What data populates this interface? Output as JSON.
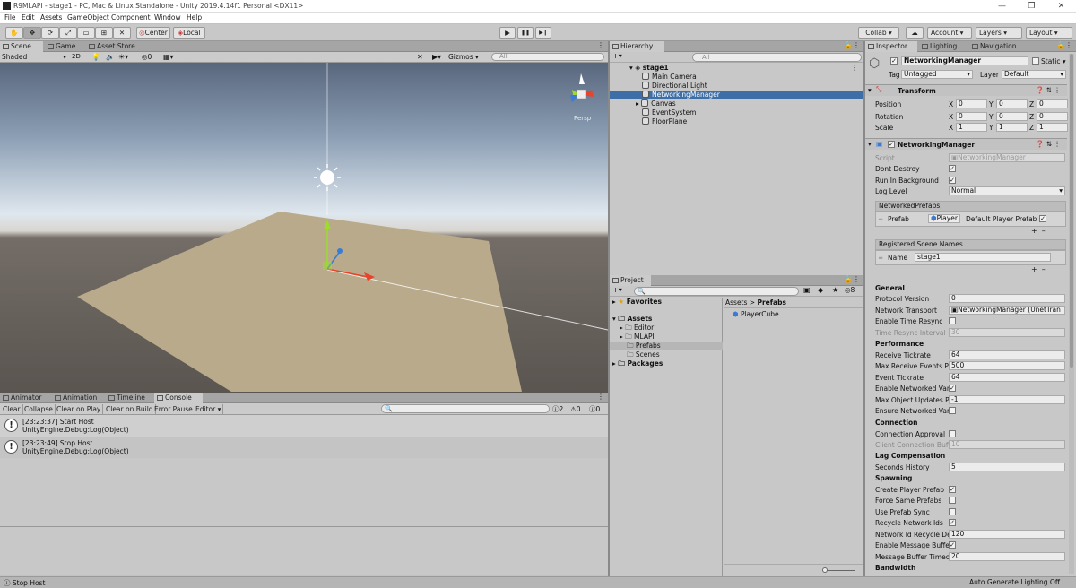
{
  "window": {
    "title": "R9MLAPI - stage1 - PC, Mac & Linux Standalone - Unity 2019.4.14f1 Personal <DX11>",
    "controls": [
      "—",
      "❐",
      "✕"
    ]
  },
  "menu": [
    "File",
    "Edit",
    "Assets",
    "GameObject",
    "Component",
    "Window",
    "Help"
  ],
  "toolbar": {
    "center": "Center",
    "local": "Local",
    "collab": "Collab ▾",
    "account": "Account",
    "layers": "Layers",
    "layout": "Layout",
    "play": "▶",
    "pause": "❚❚",
    "step": "▶❙"
  },
  "scene_tabs": [
    "Scene",
    "Game",
    "Asset Store"
  ],
  "scene_toolbar": {
    "shading": "Shaded",
    "mode2d": "2D",
    "gizmos": "Gizmos",
    "search_placeholder": "All",
    "hidden_count": "0"
  },
  "scene": {
    "persp": "Persp"
  },
  "bottom_tabs": [
    "Animator",
    "Animation",
    "Timeline",
    "Console"
  ],
  "console_buttons": [
    "Clear",
    "Collapse",
    "Clear on Play",
    "Clear on Build",
    "Error Pause",
    "Editor ▾"
  ],
  "console_counts": {
    "log": "2",
    "warn": "0",
    "error": "0"
  },
  "console_logs": [
    {
      "line1": "[23:23:37] Start Host",
      "line2": "UnityEngine.Debug:Log(Object)"
    },
    {
      "line1": "[23:23:49] Stop Host",
      "line2": "UnityEngine.Debug:Log(Object)"
    }
  ],
  "status": {
    "left": "Stop Host",
    "right": "Auto Generate Lighting Off"
  },
  "hierarchy": {
    "tab": "Hierarchy",
    "search_placeholder": "All",
    "root": "stage1",
    "items": [
      "Main Camera",
      "Directional Light",
      "NetworkingManager",
      "Canvas",
      "EventSystem",
      "FloorPlane"
    ]
  },
  "project": {
    "tab": "Project",
    "favorites": "Favorites",
    "assets": "Assets",
    "folders": [
      "Editor",
      "MLAPI",
      "Prefabs",
      "Scenes"
    ],
    "packages": "Packages",
    "breadcrumb": [
      "Assets",
      "Prefabs"
    ],
    "files": [
      "PlayerCube"
    ],
    "filter_count": "8"
  },
  "inspector": {
    "tabs": [
      "Inspector",
      "Lighting",
      "Navigation"
    ],
    "object_name": "NetworkingManager",
    "static_label": "Static",
    "tag_label": "Tag",
    "tag_value": "Untagged",
    "layer_label": "Layer",
    "layer_value": "Default",
    "transform": {
      "title": "Transform",
      "position": "Position",
      "rotation": "Rotation",
      "scale": "Scale",
      "pos": [
        "0",
        "0",
        "0"
      ],
      "rot": [
        "0",
        "0",
        "0"
      ],
      "scl": [
        "1",
        "1",
        "1"
      ]
    },
    "component_title": "NetworkingManager",
    "script_label": "Script",
    "script_value": "NetworkingManager",
    "dont_destroy": "Dont Destroy",
    "run_bg": "Run In Background",
    "log_level": "Log Level",
    "log_level_value": "Normal",
    "networked_prefabs": "NetworkedPrefabs",
    "prefab_label": "Prefab",
    "prefab_value": "Player",
    "default_player_prefab": "Default Player Prefab",
    "registered_scene_names": "Registered Scene Names",
    "name_label": "Name",
    "name_value": "stage1",
    "general": "General",
    "protocol_version": "Protocol Version",
    "protocol_value": "0",
    "network_transport": "Network Transport",
    "network_transport_value": "NetworkingManager (UnetTran",
    "enable_time_resync": "Enable Time Resync",
    "time_resync_interval": "Time Resync Interval",
    "time_resync_value": "30",
    "performance": "Performance",
    "receive_tickrate": "Receive Tickrate",
    "receive_tickrate_value": "64",
    "max_receive": "Max Receive Events Pe",
    "max_receive_value": "500",
    "event_tickrate": "Event Tickrate",
    "event_tickrate_value": "64",
    "enable_networked_var": "Enable Networked Var",
    "max_object_updates": "Max Object Updates Pe",
    "max_object_updates_value": "-1",
    "ensure_networked_var": "Ensure Networked Var",
    "connection": "Connection",
    "connection_approval": "Connection Approval",
    "client_connection_buffer": "Client Connection Buffe",
    "client_connection_buffer_value": "10",
    "lag_compensation": "Lag Compensation",
    "seconds_history": "Seconds History",
    "seconds_history_value": "5",
    "spawning": "Spawning",
    "create_player_prefab": "Create Player Prefab",
    "force_same_prefabs": "Force Same Prefabs",
    "use_prefab_sync": "Use Prefab Sync",
    "recycle_network_ids": "Recycle Network Ids",
    "network_id_recycle_delay": "Network Id Recycle De",
    "network_id_recycle_delay_value": "120",
    "enable_message_buffer": "Enable Message Buffer",
    "message_buffer_timeout": "Message Buffer Timeo",
    "message_buffer_timeout_value": "20",
    "bandwidth": "Bandwidth"
  },
  "colors": {
    "selection": "#3d6ea6",
    "panel": "#c8c8c8",
    "accent_red": "#e8432b",
    "accent_green": "#9bdc2c",
    "accent_blue": "#3a7bd5"
  }
}
